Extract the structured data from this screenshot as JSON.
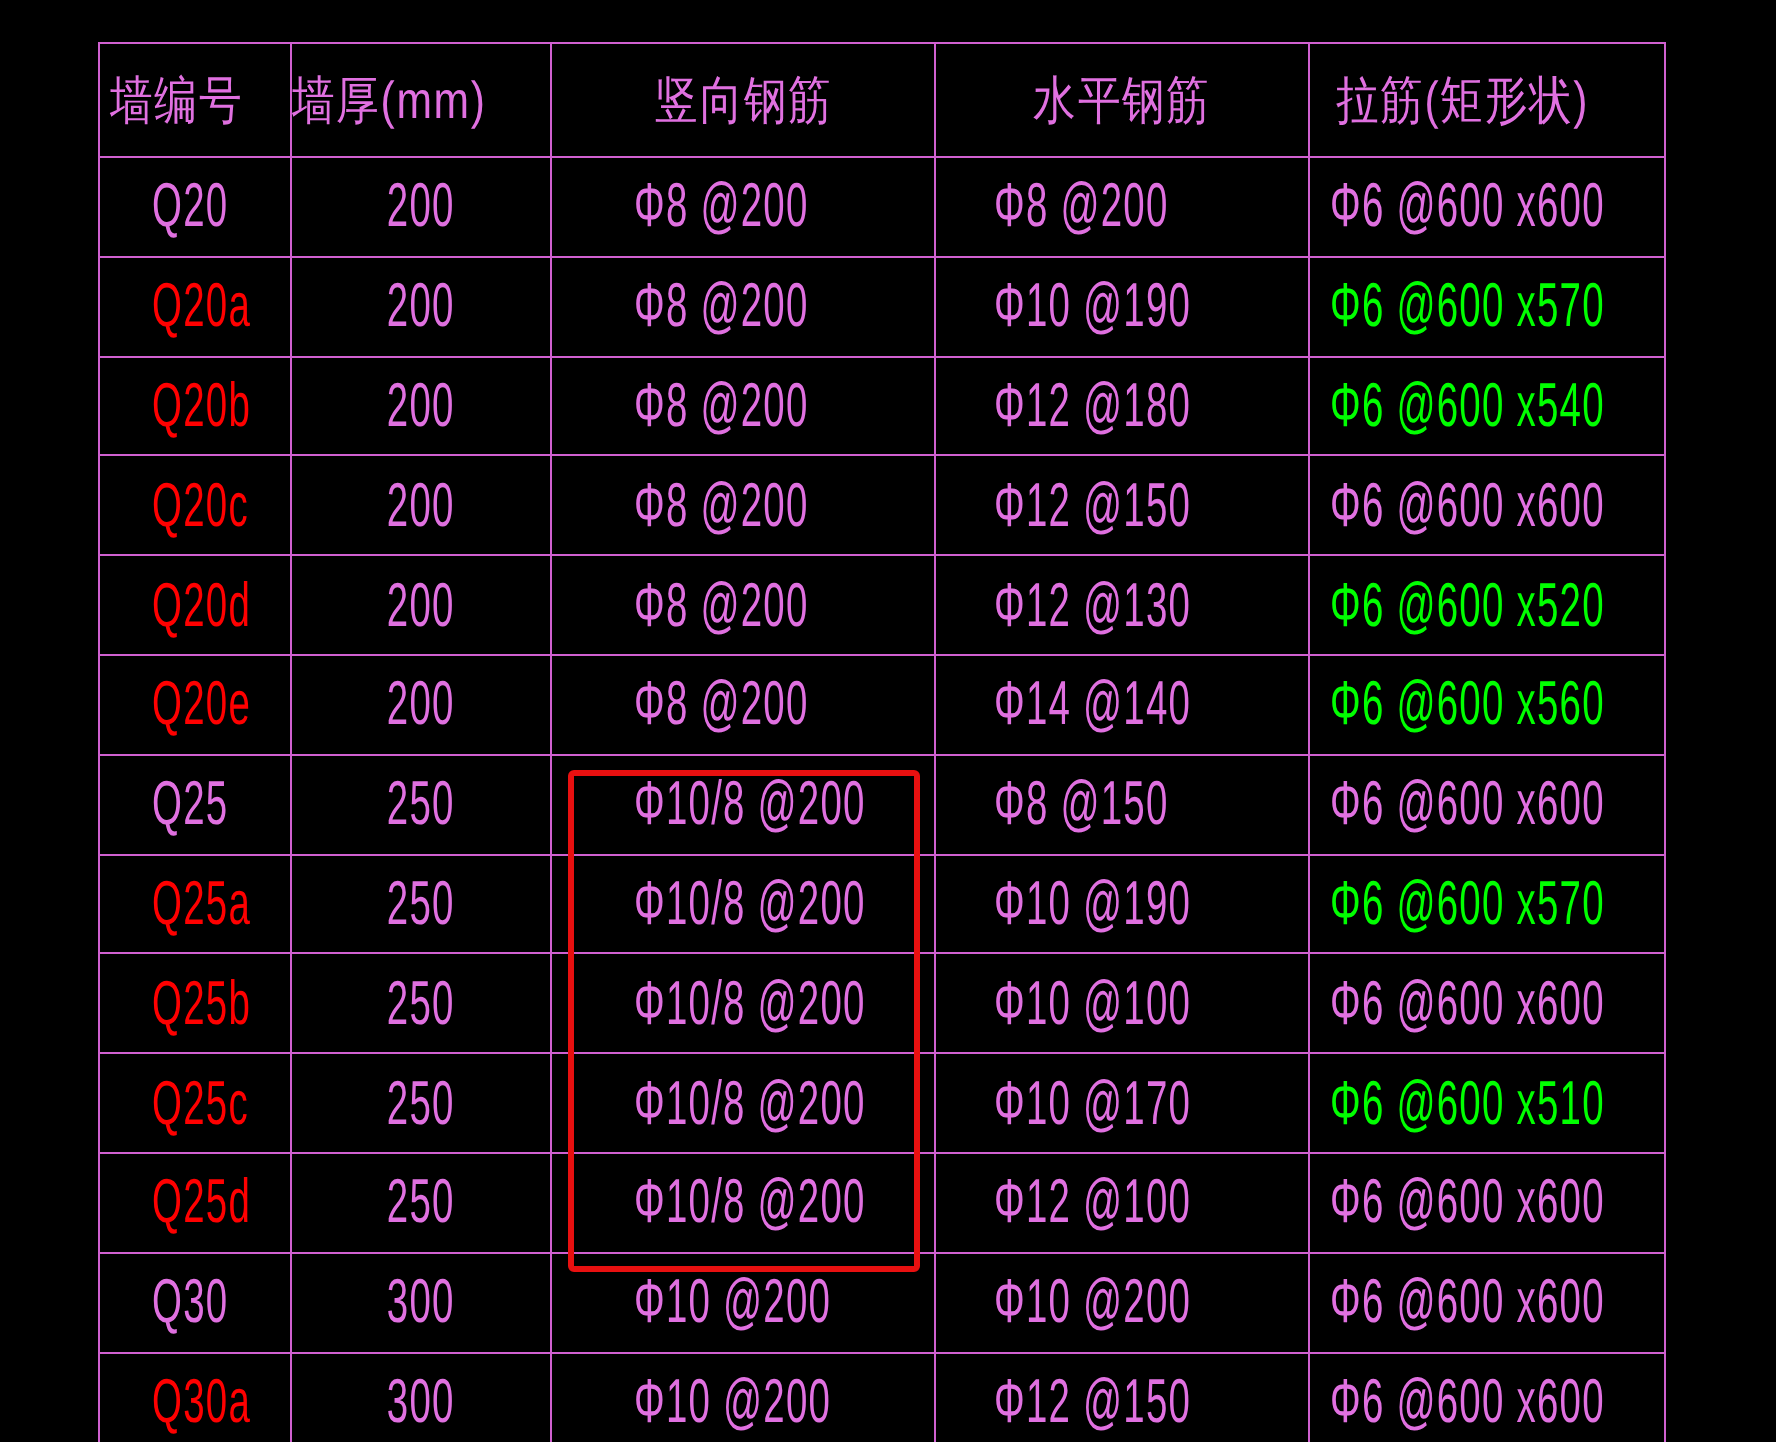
{
  "table": {
    "columns": [
      "墙编号",
      "墙厚(mm)",
      "竖向钢筋",
      "水平钢筋",
      "拉筋(矩形状)"
    ],
    "rows": [
      {
        "id": {
          "text": "Q20",
          "color": "#e070e0"
        },
        "thickness": "200",
        "vertical": "Φ8 @200",
        "horizontal": "Φ8 @200",
        "tie": {
          "text": "Φ6 @600 x600",
          "color": "#e070e0"
        },
        "highlighted": false
      },
      {
        "id": {
          "text": "Q20a",
          "color": "#ff0000"
        },
        "thickness": "200",
        "vertical": "Φ8 @200",
        "horizontal": "Φ10 @190",
        "tie": {
          "text": "Φ6 @600 x570",
          "color": "#00ff00"
        },
        "highlighted": false
      },
      {
        "id": {
          "text": "Q20b",
          "color": "#ff0000"
        },
        "thickness": "200",
        "vertical": "Φ8 @200",
        "horizontal": "Φ12 @180",
        "tie": {
          "text": "Φ6 @600 x540",
          "color": "#00ff00"
        },
        "highlighted": false
      },
      {
        "id": {
          "text": "Q20c",
          "color": "#ff0000"
        },
        "thickness": "200",
        "vertical": "Φ8 @200",
        "horizontal": "Φ12 @150",
        "tie": {
          "text": "Φ6 @600 x600",
          "color": "#e070e0"
        },
        "highlighted": false
      },
      {
        "id": {
          "text": "Q20d",
          "color": "#ff0000"
        },
        "thickness": "200",
        "vertical": "Φ8 @200",
        "horizontal": "Φ12 @130",
        "tie": {
          "text": "Φ6 @600 x520",
          "color": "#00ff00"
        },
        "highlighted": false
      },
      {
        "id": {
          "text": "Q20e",
          "color": "#ff0000"
        },
        "thickness": "200",
        "vertical": "Φ8 @200",
        "horizontal": "Φ14 @140",
        "tie": {
          "text": "Φ6 @600 x560",
          "color": "#00ff00"
        },
        "highlighted": false
      },
      {
        "id": {
          "text": "Q25",
          "color": "#e070e0"
        },
        "thickness": "250",
        "vertical": "Φ10/8 @200",
        "horizontal": "Φ8 @150",
        "tie": {
          "text": "Φ6 @600 x600",
          "color": "#e070e0"
        },
        "highlighted": true
      },
      {
        "id": {
          "text": "Q25a",
          "color": "#ff0000"
        },
        "thickness": "250",
        "vertical": "Φ10/8 @200",
        "horizontal": "Φ10 @190",
        "tie": {
          "text": "Φ6 @600 x570",
          "color": "#00ff00"
        },
        "highlighted": true
      },
      {
        "id": {
          "text": "Q25b",
          "color": "#ff0000"
        },
        "thickness": "250",
        "vertical": "Φ10/8 @200",
        "horizontal": "Φ10 @100",
        "tie": {
          "text": "Φ6 @600 x600",
          "color": "#e070e0"
        },
        "highlighted": true
      },
      {
        "id": {
          "text": "Q25c",
          "color": "#ff0000"
        },
        "thickness": "250",
        "vertical": "Φ10/8 @200",
        "horizontal": "Φ10 @170",
        "tie": {
          "text": "Φ6 @600 x510",
          "color": "#00ff00"
        },
        "highlighted": true
      },
      {
        "id": {
          "text": "Q25d",
          "color": "#ff0000"
        },
        "thickness": "250",
        "vertical": "Φ10/8 @200",
        "horizontal": "Φ12 @100",
        "tie": {
          "text": "Φ6 @600 x600",
          "color": "#e070e0"
        },
        "highlighted": true
      },
      {
        "id": {
          "text": "Q30",
          "color": "#e070e0"
        },
        "thickness": "300",
        "vertical": "Φ10 @200",
        "horizontal": "Φ10 @200",
        "tie": {
          "text": "Φ6 @600 x600",
          "color": "#e070e0"
        },
        "highlighted": false
      },
      {
        "id": {
          "text": "Q30a",
          "color": "#ff0000"
        },
        "thickness": "300",
        "vertical": "Φ10 @200",
        "horizontal": "Φ12 @150",
        "tie": {
          "text": "Φ6 @600 x600",
          "color": "#e070e0"
        },
        "highlighted": false
      }
    ]
  }
}
